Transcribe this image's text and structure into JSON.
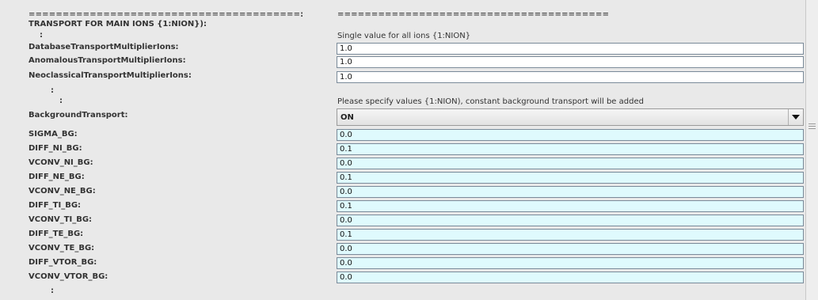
{
  "separators": {
    "left": "========================================:",
    "right": "========================================"
  },
  "section_title": "TRANSPORT FOR MAIN IONS {1:NION}):",
  "colon": ":",
  "hints": {
    "single": "Single value for all ions {1:NION}",
    "specify": "Please specify values {1:NION), constant background transport will be added"
  },
  "multipliers": [
    {
      "label": "DatabaseTransportMultiplierIons:",
      "value": "1.0"
    },
    {
      "label": "AnomalousTransportMultiplierIons:",
      "value": "1.0"
    },
    {
      "label": "NeoclassicalTransportMultiplierIons:",
      "value": "1.0"
    }
  ],
  "background_transport": {
    "label": "BackgroundTransport:",
    "selected": "ON",
    "arrow_icon": "chevron-down-icon"
  },
  "bg_params": [
    {
      "label": "SIGMA_BG:",
      "value": "0.0"
    },
    {
      "label": "DIFF_NI_BG:",
      "value": "0.1"
    },
    {
      "label": "VCONV_NI_BG:",
      "value": "0.0"
    },
    {
      "label": "DIFF_NE_BG:",
      "value": "0.1"
    },
    {
      "label": "VCONV_NE_BG:",
      "value": "0.0"
    },
    {
      "label": "DIFF_TI_BG:",
      "value": "0.1"
    },
    {
      "label": "VCONV_TI_BG:",
      "value": "0.0"
    },
    {
      "label": "DIFF_TE_BG:",
      "value": "0.1"
    },
    {
      "label": "VCONV_TE_BG:",
      "value": "0.0"
    },
    {
      "label": "DIFF_VTOR_BG:",
      "value": "0.0"
    },
    {
      "label": "VCONV_VTOR_BG:",
      "value": "0.0"
    }
  ],
  "colors": {
    "panel": "#e9e9e9",
    "field_bg_cyan": "#dffafd",
    "field_border": "#7a8a99"
  }
}
